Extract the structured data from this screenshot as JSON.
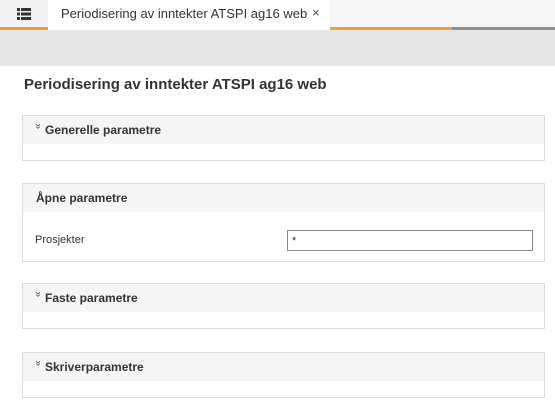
{
  "tabs": [
    {
      "label": "Periodisering av inntekter ATSPI ag16 web",
      "close": "×"
    }
  ],
  "page": {
    "title": "Periodisering av inntekter ATSPI ag16 web"
  },
  "panels": {
    "generelle": {
      "title": "Generelle parametre",
      "chevron": "»"
    },
    "apne": {
      "title": "Åpne parametre"
    },
    "faste": {
      "title": "Faste parametre",
      "chevron": "»"
    },
    "skriver": {
      "title": "Skriverparametre",
      "chevron": "»"
    }
  },
  "fields": {
    "prosjekter": {
      "label": "Prosjekter",
      "value": "*"
    }
  },
  "colors": {
    "accent": "#f39b37",
    "tab_underline_grey": "#8f8f8f",
    "toolbar": "#e6e6e6"
  },
  "icons": {
    "menu": "list-icon",
    "close": "close-icon",
    "collapse": "double-chevron-down-icon"
  }
}
